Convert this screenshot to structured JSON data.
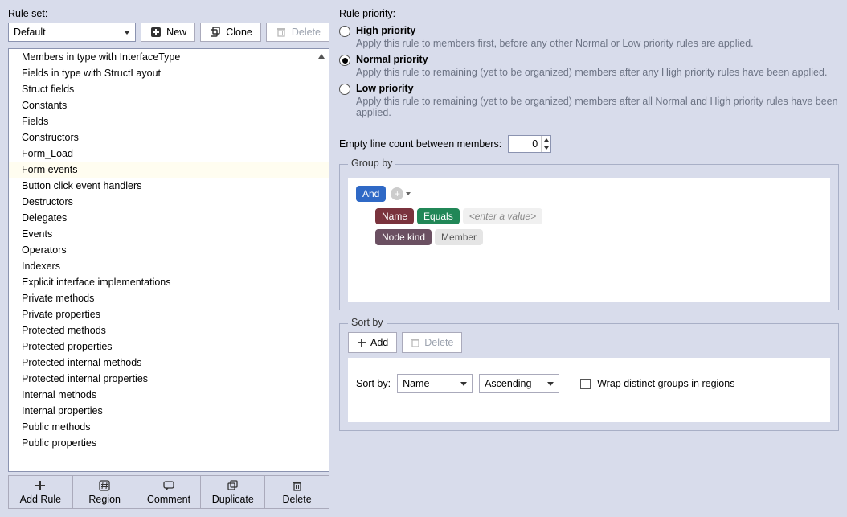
{
  "left": {
    "ruleset_label": "Rule set:",
    "ruleset_selected": "Default",
    "new_btn": "New",
    "clone_btn": "Clone",
    "delete_btn": "Delete",
    "rules": [
      "Members in type with InterfaceType",
      "Fields in type with StructLayout",
      "Struct fields",
      "Constants",
      "Fields",
      "Constructors",
      "Form_Load",
      "Form events",
      "Button click event handlers",
      "Destructors",
      "Delegates",
      "Events",
      "Operators",
      "Indexers",
      "Explicit interface implementations",
      "Private methods",
      "Private properties",
      "Protected methods",
      "Protected properties",
      "Protected internal methods",
      "Protected internal properties",
      "Internal methods",
      "Internal properties",
      "Public methods",
      "Public properties"
    ],
    "selected_rule_index": 7,
    "bottom_buttons": {
      "add_rule": "Add Rule",
      "region": "Region",
      "comment": "Comment",
      "duplicate": "Duplicate",
      "delete": "Delete"
    }
  },
  "right": {
    "priority_label": "Rule priority:",
    "high_title": "High priority",
    "high_desc": "Apply this rule to members first, before any other Normal or Low priority rules are applied.",
    "normal_title": "Normal priority",
    "normal_desc": "Apply this rule to remaining (yet to be organized) members after any High priority rules have been applied.",
    "low_title": "Low priority",
    "low_desc": "Apply this rule to remaining (yet to be organized) members after all Normal and High priority rules have been applied.",
    "selected_priority": 1,
    "empty_line_label": "Empty line count between members:",
    "empty_line_value": "0",
    "groupby_title": "Group by",
    "groupby_and": "And",
    "groupby_name": "Name",
    "groupby_equals": "Equals",
    "groupby_placeholder": "<enter a value>",
    "groupby_nodekind": "Node kind",
    "groupby_member": "Member",
    "sortby_title": "Sort by",
    "add_btn": "Add",
    "delete_btn": "Delete",
    "sortby_label": "Sort by:",
    "sortby_field": "Name",
    "sortby_dir": "Ascending",
    "wrap_label": "Wrap distinct groups in regions"
  }
}
